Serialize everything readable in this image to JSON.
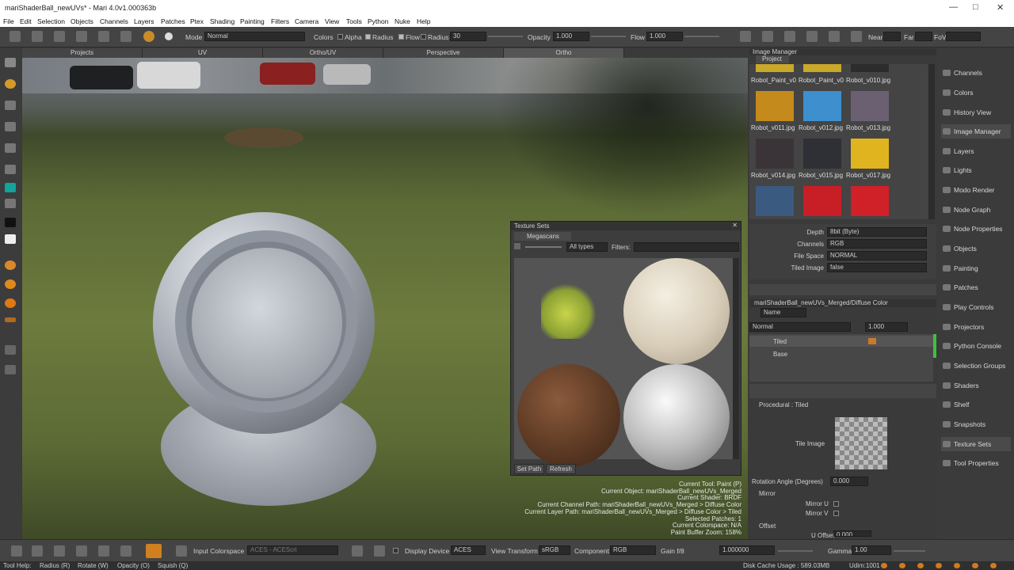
{
  "window": {
    "title": "mariShaderBall_newUVs* - Mari 4.0v1.000363b"
  },
  "menu": [
    "File",
    "Edit",
    "Selection",
    "Objects",
    "Channels",
    "Layers",
    "Patches",
    "Ptex",
    "Shading",
    "Painting",
    "Filters",
    "Camera",
    "View",
    "Tools",
    "Python",
    "Nuke",
    "Help"
  ],
  "toolbar": {
    "mode_label": "Mode",
    "mode_value": "Normal",
    "colors": "Colors",
    "alpha": "Alpha",
    "radius_chk": "Radius",
    "flow_chk": "Flow",
    "radius_label": "Radius",
    "radius_value": "30",
    "opacity_label": "Opacity",
    "opacity_value": "1.000",
    "flow_label": "Flow",
    "flow_value": "1.000",
    "near": "Near",
    "far": "Far",
    "fov": "FoV"
  },
  "view_tabs": [
    "Projects",
    "UV",
    "Ortho/UV",
    "Perspective",
    "Ortho"
  ],
  "status_lines": [
    "Current Tool: Paint (P)",
    "Current Object: mariShaderBall_newUVs_Merged",
    "Current Shader: BRDF",
    "Current Channel Path: mariShaderBall_newUVs_Merged > Diffuse Color",
    "Current Layer Path: mariShaderBall_newUVs_Merged > Diffuse Color > Tiled",
    "Selected Patches: 1",
    "Current Colorspace: N/A",
    "Paint Buffer Zoom: 158%"
  ],
  "texture_sets": {
    "title": "Texture Sets",
    "tab": "Megascans",
    "type_filter": "All types",
    "filters_label": "Filters:",
    "set_path": "Set Path",
    "refresh": "Refresh"
  },
  "image_manager": {
    "title": "Image Manager",
    "tab": "Project",
    "labels": [
      "Robot_Paint_v0",
      "Robot_Paint_v0",
      "Robot_v010.jpg",
      "Robot_v011.jpg",
      "Robot_v012.jpg",
      "Robot_v013.jpg",
      "Robot_v014.jpg",
      "Robot_v015.jpg",
      "Robot_v017.jpg"
    ],
    "props": [
      {
        "k": "Depth",
        "v": "8bit  (Byte)"
      },
      {
        "k": "Channels",
        "v": "RGB"
      },
      {
        "k": "File Space",
        "v": "NORMAL"
      },
      {
        "k": "Tiled Image",
        "v": "false"
      }
    ]
  },
  "layers": {
    "path": "mariShaderBall_newUVs_Merged/Diffuse Color",
    "name_filter": "Name",
    "blend": "Normal",
    "opacity": "1.000",
    "items": [
      "Tiled",
      "Base"
    ]
  },
  "procedural": {
    "header": "Procedural : Tiled",
    "tile_image": "Tile Image",
    "rotation_label": "Rotation Angle (Degrees)",
    "rotation_value": "0.000",
    "mirror": "Mirror",
    "mirror_u": "Mirror U",
    "mirror_v": "Mirror V",
    "offset": "Offset",
    "uoffset": "U Offset",
    "uoffset_value": "0.000"
  },
  "palettes": [
    "Channels",
    "Colors",
    "History View",
    "Image Manager",
    "Layers",
    "Lights",
    "Modo Render",
    "Node Graph",
    "Node Properties",
    "Objects",
    "Painting",
    "Patches",
    "Play Controls",
    "Projectors",
    "Python Console",
    "Selection Groups",
    "Shaders",
    "Shelf",
    "Snapshots",
    "Texture Sets",
    "Tool Properties"
  ],
  "bottom": {
    "input_cs": "Input Colorspace",
    "input_cs_value": "ACES - ACEScri",
    "display_device": "Display Device",
    "display_device_value": "ACES",
    "view_transform": "View Transform",
    "view_transform_value": "sRGB",
    "component": "Component",
    "component_value": "RGB",
    "gain": "Gain f/8",
    "gain_value": "1.000000",
    "gamma": "Gamma",
    "gamma_value": "1.00"
  },
  "help": {
    "tool_help": "Tool Help:",
    "hint1": "Radius (R)",
    "hint2": "Rotate (W)",
    "hint3": "Opacity (O)",
    "hint4": "Squish (Q)",
    "disk": "Disk Cache Usage : 589.03MB",
    "udim": "Udim:1001"
  },
  "colors": {
    "accent": "#e8a030",
    "viewport_grass": "#5c6a36",
    "panel": "#3a3a3a"
  }
}
